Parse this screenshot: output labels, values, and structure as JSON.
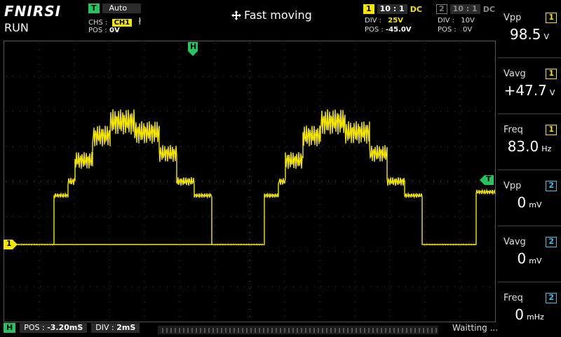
{
  "header": {
    "brand": "FNIRSI",
    "state": "RUN",
    "trigger_badge": "T",
    "trigger_mode": "Auto",
    "chs_label": "CHS :",
    "chs_value": "CH1",
    "edge_symbol": "ł",
    "pos_label": "POS :",
    "pos_value": "0V",
    "mode_text": "Fast moving",
    "ch1": {
      "index": "1",
      "ratio": "10 : 1",
      "coupling": "DC",
      "div_label": "DIV :",
      "div_value": "25V",
      "pos_label": "POS :",
      "pos_value": "-45.0V"
    },
    "ch2": {
      "index": "2",
      "ratio": "10 : 1",
      "coupling": "DC",
      "div_label": "DIV :",
      "div_value": "10V",
      "pos_label": "POS :",
      "pos_value": "0V"
    }
  },
  "markers": {
    "h": "H",
    "ch1": "1",
    "trigger": "T"
  },
  "measurements": [
    {
      "title": "Vpp",
      "channel": "1",
      "value": "98.5",
      "unit": "V",
      "color": "#f5e600"
    },
    {
      "title": "Vavg",
      "channel": "1",
      "value": "+47.7",
      "unit": "V",
      "color": "#f5e600"
    },
    {
      "title": "Freq",
      "channel": "1",
      "value": "83.0",
      "unit": "Hz",
      "color": "#f5e600"
    },
    {
      "title": "Vpp",
      "channel": "2",
      "value": "0",
      "unit": "mV",
      "color": "#3ec1e6"
    },
    {
      "title": "Vavg",
      "channel": "2",
      "value": "0",
      "unit": "mV",
      "color": "#3ec1e6"
    },
    {
      "title": "Freq",
      "channel": "2",
      "value": "0",
      "unit": "mHz",
      "color": "#3ec1e6"
    }
  ],
  "footer": {
    "h_badge": "H",
    "pos_label": "POS :",
    "pos_value": "-3.20mS",
    "div_label": "DIV :",
    "div_value": "2mS",
    "status": "Waitting ..."
  },
  "colors": {
    "ch1": "#f5e600",
    "ch2": "#3ec1e6",
    "trigger": "#22c55e",
    "grid": "#3a3a3a"
  }
}
